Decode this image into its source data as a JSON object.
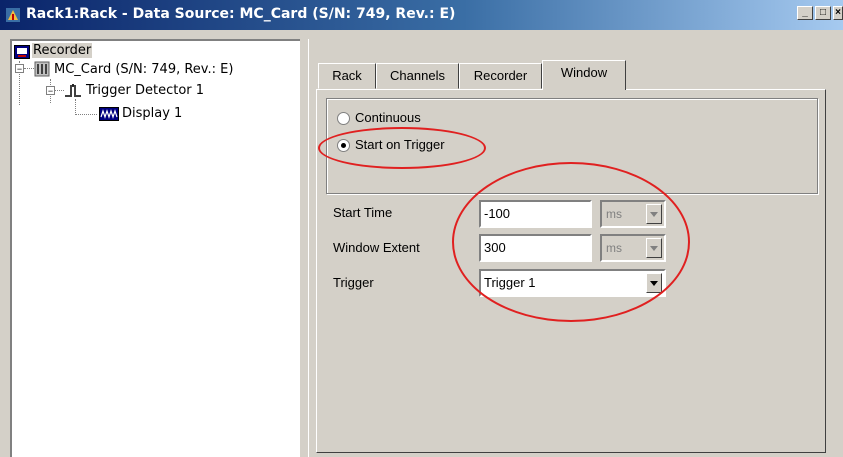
{
  "window": {
    "title": "Rack1:Rack - Data Source: MC_Card (S/N: 749, Rev.: E)",
    "minimize_glyph": "_",
    "maximize_glyph": "□",
    "close_glyph": "×"
  },
  "tree": {
    "items": [
      {
        "label": "Recorder",
        "icon": "recorder-icon"
      },
      {
        "label": "MC_Card (S/N: 749, Rev.: E)",
        "icon": "card-icon"
      },
      {
        "label": "Trigger Detector 1",
        "icon": "trigger-detector-icon"
      },
      {
        "label": "Display 1",
        "icon": "display-icon"
      }
    ]
  },
  "tabs": [
    {
      "label": "Rack"
    },
    {
      "label": "Channels"
    },
    {
      "label": "Recorder"
    },
    {
      "label": "Window",
      "active": true
    }
  ],
  "mode": {
    "options": [
      {
        "label": "Continuous",
        "selected": false
      },
      {
        "label": "Start on Trigger",
        "selected": true
      }
    ]
  },
  "fields": {
    "start_time": {
      "label": "Start Time",
      "value": "-100",
      "unit": "ms"
    },
    "window_extent": {
      "label": "Window Extent",
      "value": "300",
      "unit": "ms"
    },
    "trigger": {
      "label": "Trigger",
      "value": "Trigger 1"
    }
  },
  "colors": {
    "annotation": "#e02020",
    "titlebar_start": "#0a246a",
    "titlebar_end": "#a6caf0",
    "face": "#d4d0c8"
  }
}
